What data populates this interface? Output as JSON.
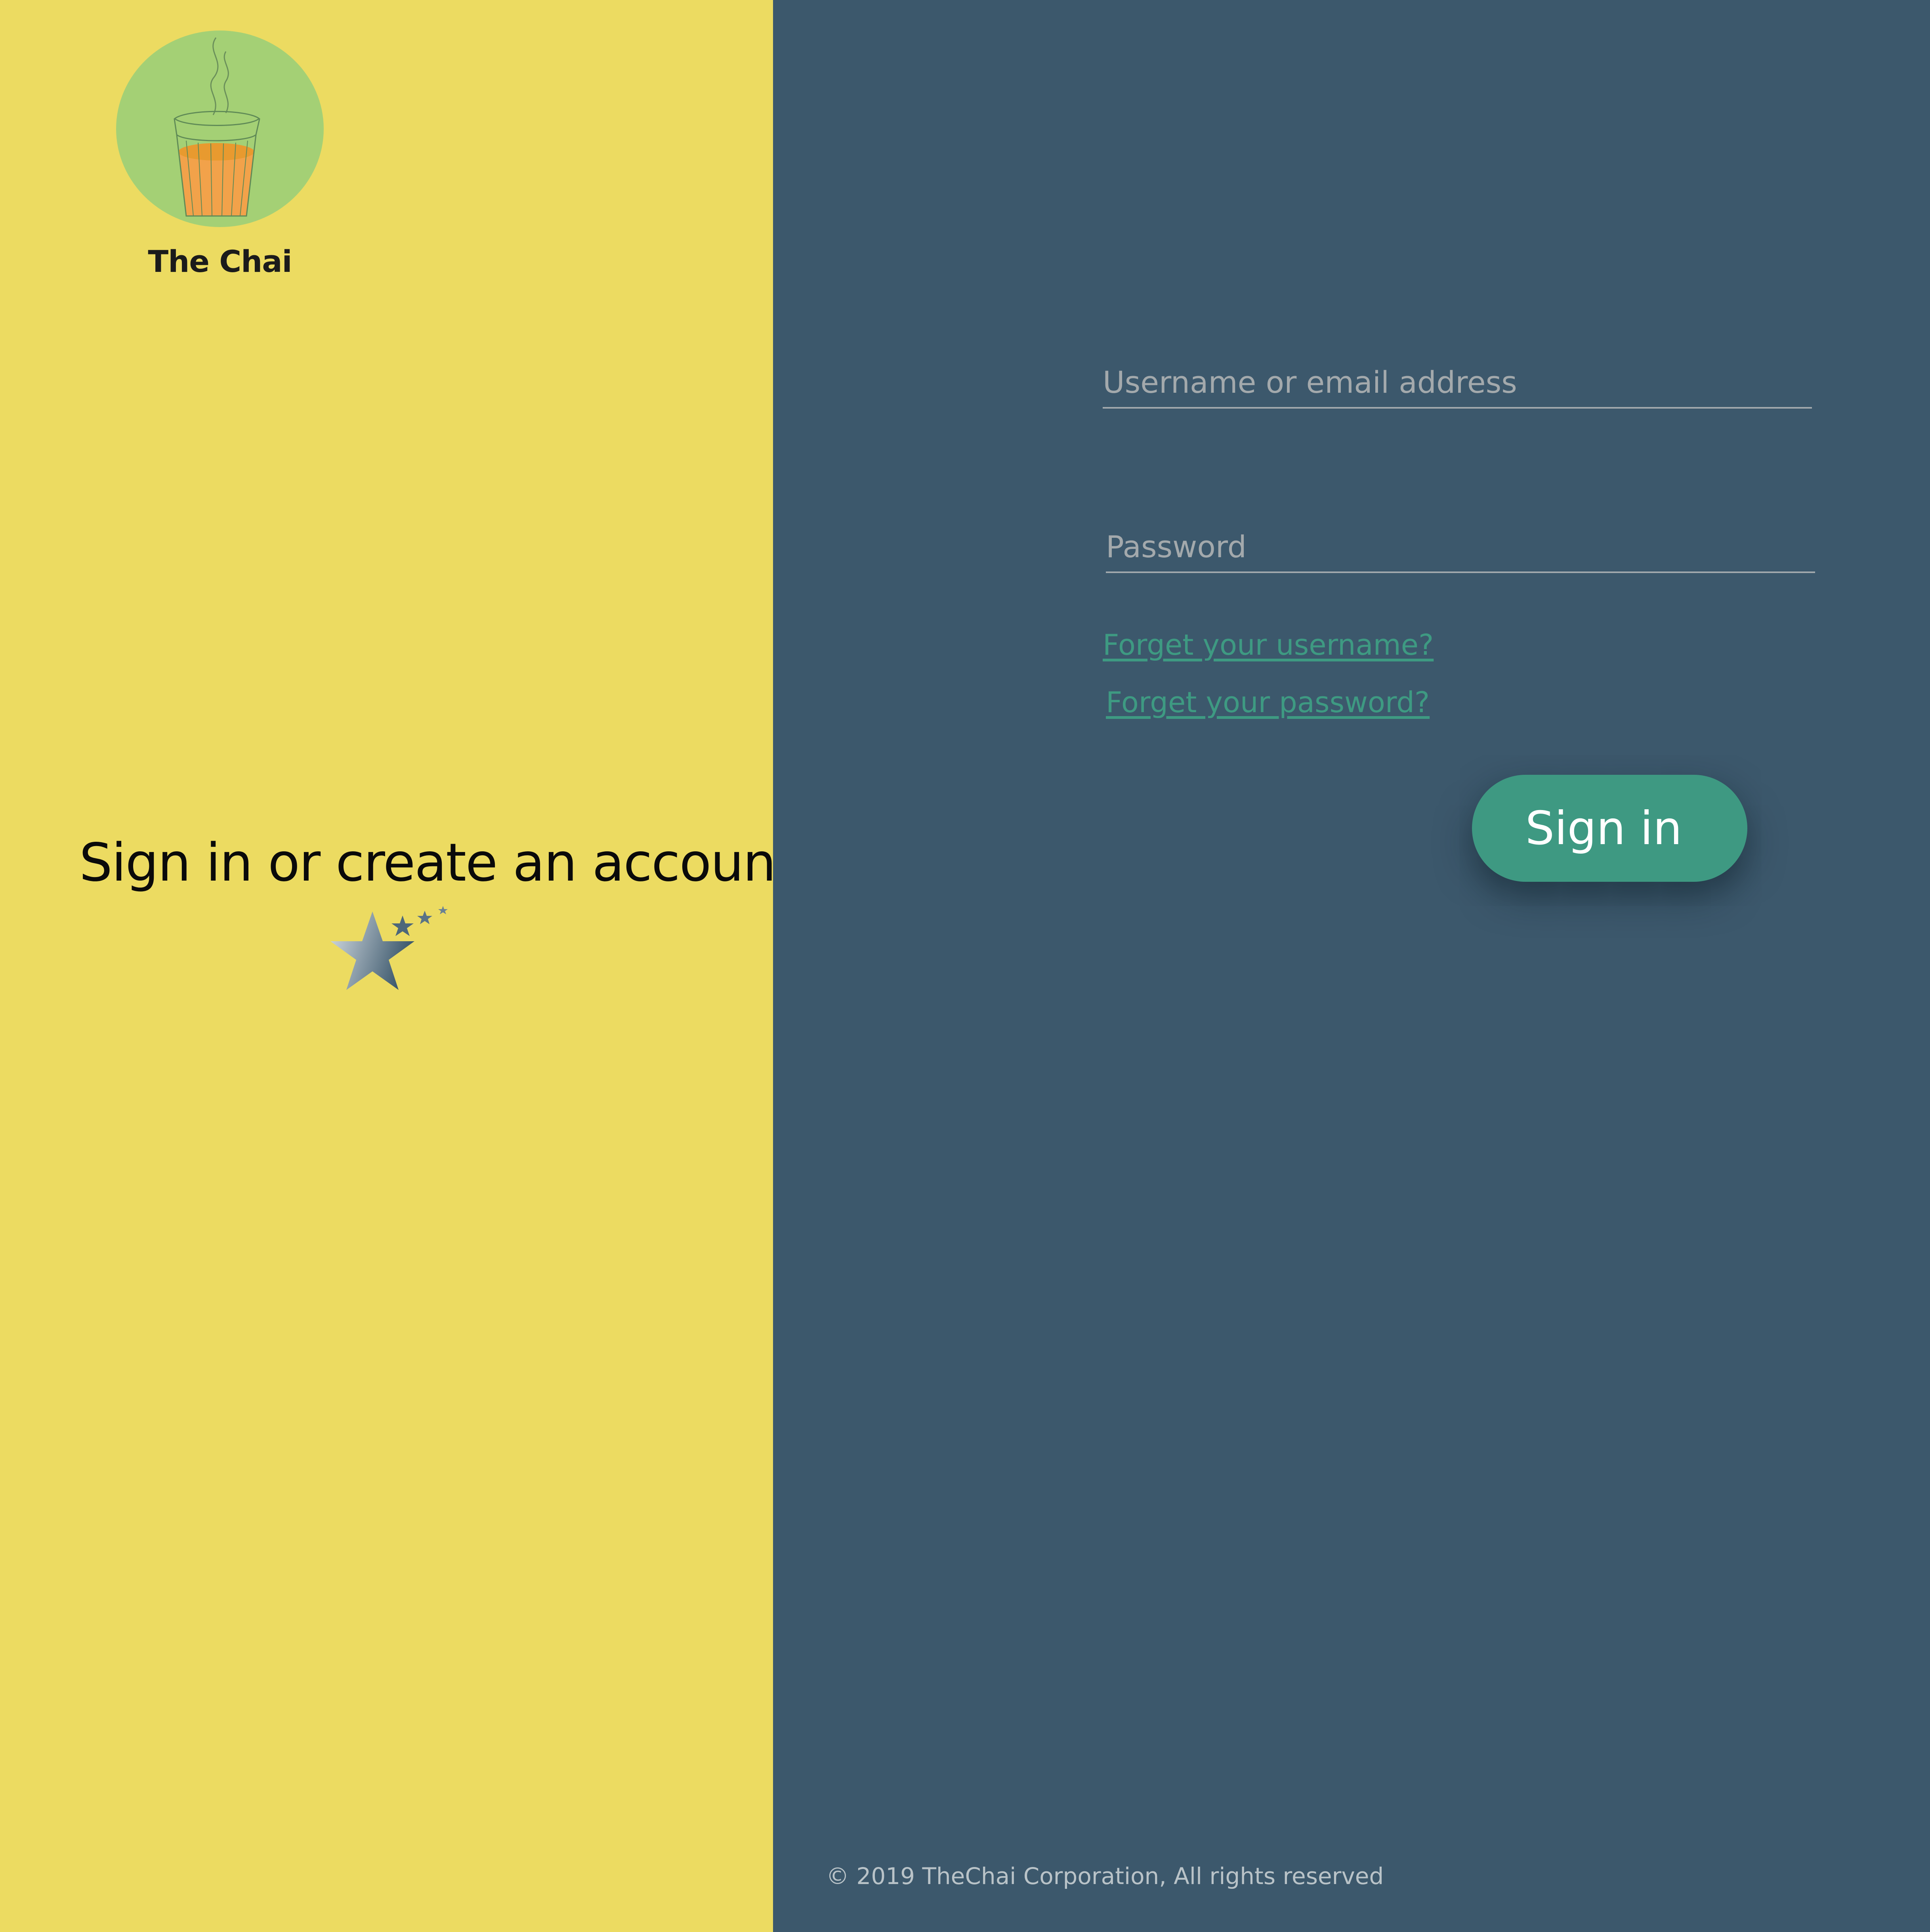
{
  "brand": {
    "name": "The Chai",
    "logo_icon": "chai-glass-logo"
  },
  "hero": {
    "heading": "Sign in or create an account",
    "decoration_icon": "shooting-star-icon"
  },
  "form": {
    "username_placeholder": "Username or email address",
    "password_placeholder": "Password",
    "forgot_username_label": "Forget your username?",
    "forgot_password_label": "Forget your password?",
    "signin_label": "Sign in"
  },
  "footer": {
    "copyright": "© 2019 TheChai Corporation, All rights reserved"
  },
  "colors": {
    "left_panel": "#ecdb61",
    "right_panel": "#3c586c",
    "accent": "#3e9982",
    "logo_circle": "#a4d075",
    "tea": "#f2a24a"
  }
}
